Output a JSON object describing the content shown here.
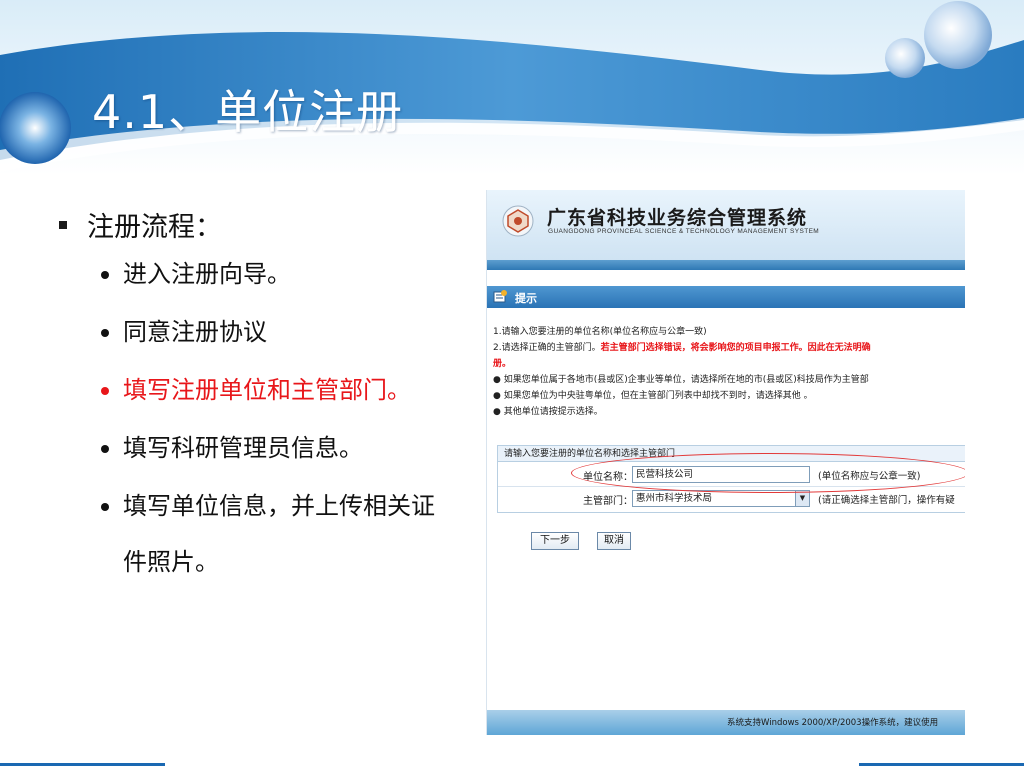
{
  "slide": {
    "title": "4.1、单位注册",
    "bullet_main": "注册流程：",
    "steps": [
      {
        "text": "进入注册向导。",
        "highlight": false
      },
      {
        "text": "同意注册协议",
        "highlight": false
      },
      {
        "text": "填写注册单位和主管部门。",
        "highlight": true
      },
      {
        "text": "填写科研管理员信息。",
        "highlight": false
      },
      {
        "text": "填写单位信息，并上传相关证件照片。",
        "highlight": false
      }
    ],
    "highlight_color": "#e8161a"
  },
  "screenshot": {
    "system_title": "广东省科技业务综合管理系统",
    "system_subtitle": "GUANGDONG PROVINCEAL SCIENCE & TECHNOLOGY MANAGEMENT SYSTEM",
    "tip_label": "提示",
    "notice": {
      "line1": "1.请输入您要注册的单位名称(单位名称应与公章一致)",
      "line2_prefix": "2.请选择正确的主管部门。",
      "line2_warn": "若主管部门选择错误，将会影响您的项目申报工作。因此在无法明确",
      "line2_cont": "册。",
      "bullet1": "●  如果您单位属于各地市(县或区)企事业等单位，请选择所在地的市(县或区)科技局作为主管部",
      "bullet2": "●  如果您单位为中央驻粤单位，但在主管部门列表中却找不到时，请选择其他  。",
      "bullet3": "●  其他单位请按提示选择。"
    },
    "form": {
      "heading": "请输入您要注册的单位名称和选择主管部门",
      "unit_label": "单位名称：",
      "unit_value": "民营科技公司",
      "unit_hint": "(单位名称应与公章一致)",
      "dept_label": "主管部门：",
      "dept_value": "惠州市科学技术局",
      "dept_hint": "(请正确选择主管部门，操作有疑"
    },
    "buttons": {
      "next": "下一步",
      "cancel": "取消"
    },
    "footer": "系统支持Windows 2000/XP/2003操作系统，建议使用"
  }
}
